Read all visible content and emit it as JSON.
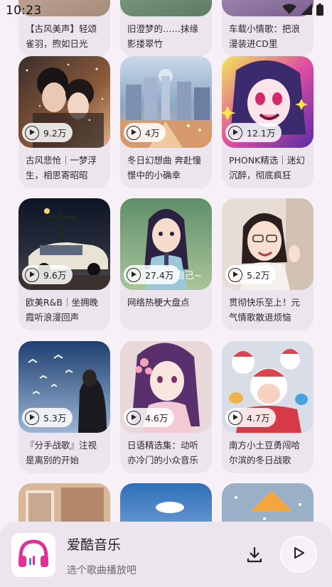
{
  "status_bar": {
    "time": "10:23"
  },
  "top_partial": [
    {
      "title": "【古风美声】轻颂雀羽，煦如日光"
    },
    {
      "title": "旧澄梦的……抹缘影搂翠竹"
    },
    {
      "title": "车载小情歌：把浪漫装进CD里"
    }
  ],
  "rows": [
    [
      {
        "play_count": "9.2万",
        "title": "古风悲怆｜一梦浮生，相思寄昭昭"
      },
      {
        "play_count": "4万",
        "title": "冬日幻想曲 奔赴憧憬中的小确幸"
      },
      {
        "play_count": "12.1万",
        "title": "PHONK精选｜迷幻沉醉，彻底疯狂"
      }
    ],
    [
      {
        "play_count": "9.6万",
        "title": "欧美R&B｜坐拥晚霞听浪漫回声"
      },
      {
        "play_count": "27.4万",
        "title": "网络热梗大盘点"
      },
      {
        "play_count": "5.2万",
        "title": "贯彻快乐至上！元气情歌散退烦恼"
      }
    ],
    [
      {
        "play_count": "5.3万",
        "title": "『分手战歌』注视是离别的开始"
      },
      {
        "play_count": "4.6万",
        "title": "日语精选集：动听亦冷门的小众音乐"
      },
      {
        "play_count": "4.7万",
        "title": "南方小土豆勇闯哈尔滨的冬日战歌"
      }
    ]
  ],
  "cover_overlay_text": "自己~",
  "mini_player": {
    "app_name": "爱酷音乐",
    "subtitle": "选个歌曲播放吧",
    "logo_icon": "headphones-icon",
    "download_icon": "download-icon",
    "play_icon": "play-icon"
  },
  "colors": {
    "background": "#f7f1f7",
    "card": "#ece5ee",
    "accent": "#e0309a"
  }
}
